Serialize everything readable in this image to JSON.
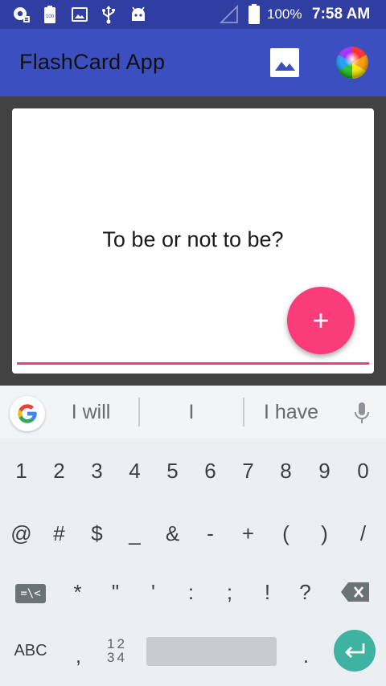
{
  "status_bar": {
    "battery_percent": "100%",
    "time": "7:58 AM",
    "icons": [
      "app-notification-icon",
      "battery-saver-icon",
      "image-icon",
      "usb-icon",
      "android-icon",
      "signal-icon",
      "battery-icon"
    ]
  },
  "app_bar": {
    "title": "FlashCard App",
    "actions": [
      "image-icon",
      "color-wheel-icon"
    ]
  },
  "card": {
    "question": "To be or not to be?",
    "fab_label": "+"
  },
  "keyboard": {
    "suggestions": [
      "I will",
      "I",
      "I have"
    ],
    "rows": [
      [
        "1",
        "2",
        "3",
        "4",
        "5",
        "6",
        "7",
        "8",
        "9",
        "0"
      ],
      [
        "@",
        "#",
        "$",
        "_",
        "&",
        "-",
        "+",
        "(",
        ")",
        "/"
      ],
      [
        "*",
        "\"",
        "'",
        ":",
        ";",
        "!",
        "?"
      ]
    ],
    "symbol_toggle": "=\\<",
    "abc_label": "ABC",
    "comma": ",",
    "numpad_top": "12",
    "numpad_bottom": "34",
    "period": "."
  },
  "colors": {
    "status_bar": "#2f3ea0",
    "app_bar": "#3b4fc0",
    "fab": "#fb3c7a",
    "enter_key": "#3fb3a2"
  }
}
